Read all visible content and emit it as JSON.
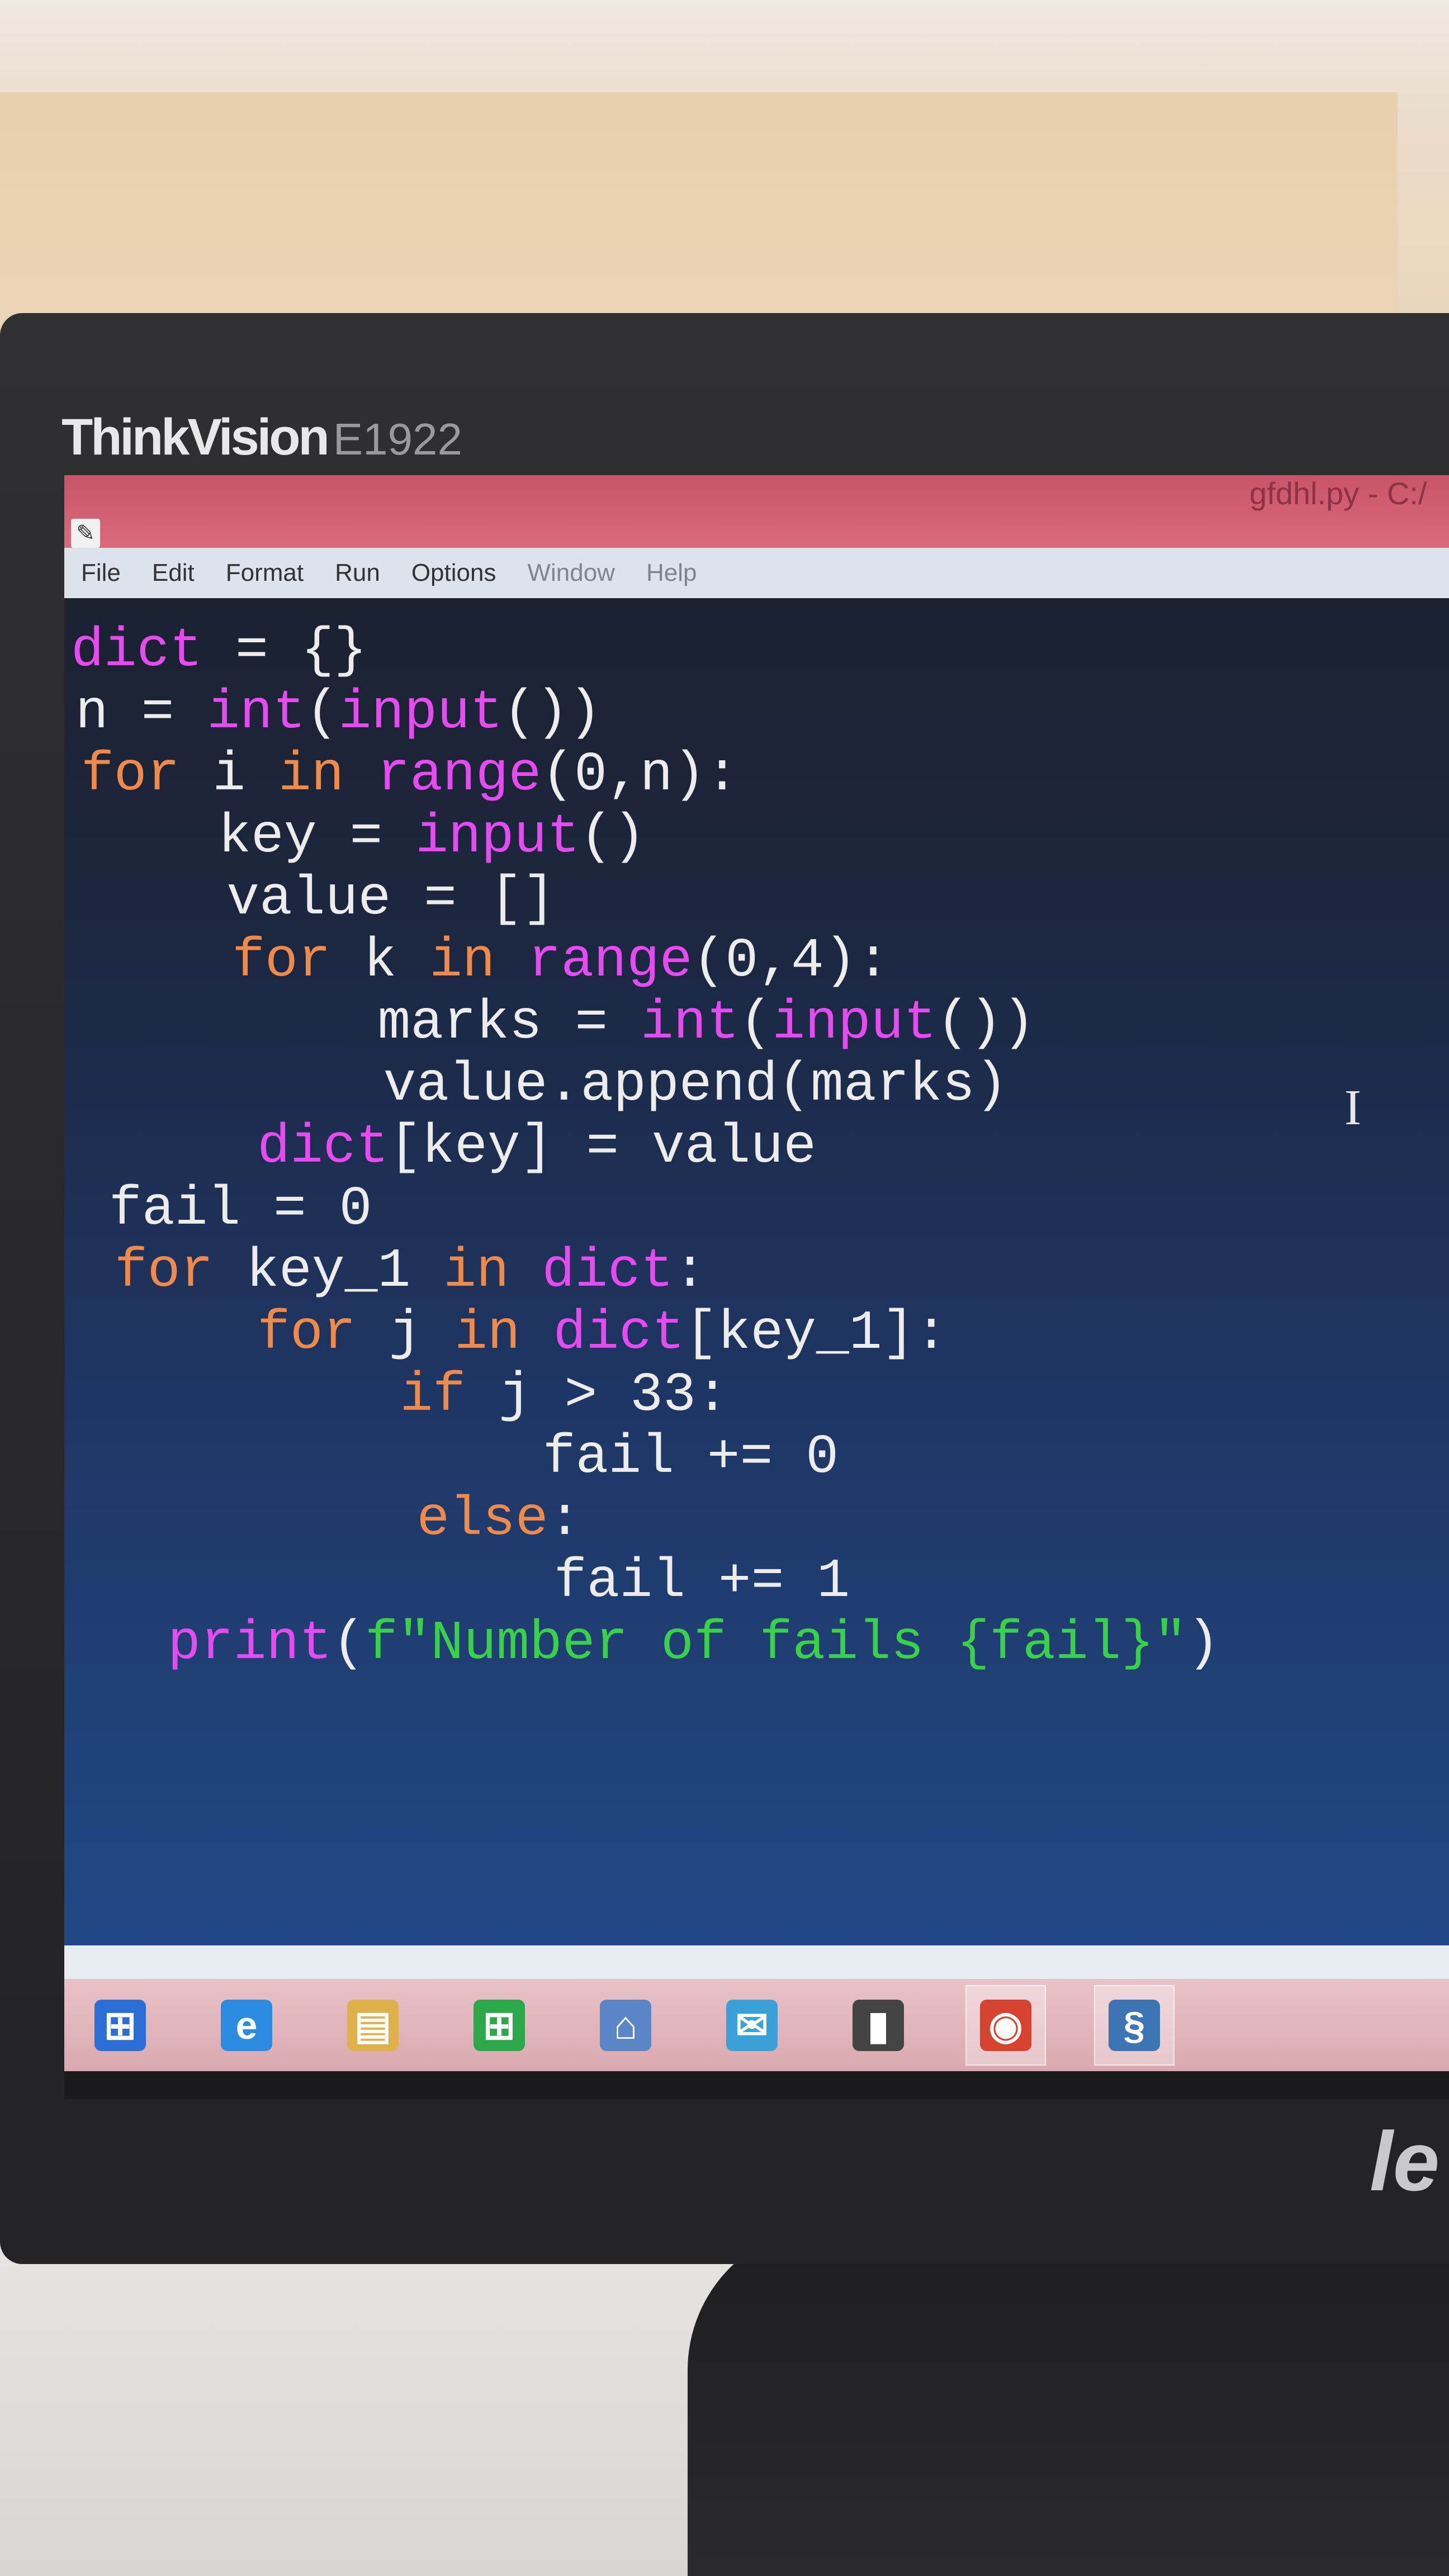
{
  "monitor": {
    "brand": "ThinkVision",
    "model": "E1922",
    "bezel_logo": "le"
  },
  "window": {
    "title": "gfdhl.py - C:/",
    "app_icon": "idle-icon"
  },
  "menubar": {
    "items": [
      "File",
      "Edit",
      "Format",
      "Run",
      "Options",
      "Window",
      "Help"
    ]
  },
  "code": [
    [
      {
        "t": "dict",
        "c": "bi"
      },
      {
        "t": " = {}",
        "c": ""
      }
    ],
    [
      {
        "t": "n = ",
        "c": ""
      },
      {
        "t": "int",
        "c": "bi"
      },
      {
        "t": "(",
        "c": ""
      },
      {
        "t": "input",
        "c": "bi"
      },
      {
        "t": "())",
        "c": ""
      }
    ],
    [
      {
        "t": "for",
        "c": "kw"
      },
      {
        "t": " i ",
        "c": ""
      },
      {
        "t": "in",
        "c": "kw"
      },
      {
        "t": " ",
        "c": ""
      },
      {
        "t": "range",
        "c": "bi"
      },
      {
        "t": "(0,n):",
        "c": ""
      }
    ],
    [
      {
        "t": "    key = ",
        "c": ""
      },
      {
        "t": "input",
        "c": "bi"
      },
      {
        "t": "()",
        "c": ""
      }
    ],
    [
      {
        "t": "    value = []",
        "c": ""
      }
    ],
    [
      {
        "t": "    ",
        "c": ""
      },
      {
        "t": "for",
        "c": "kw"
      },
      {
        "t": " k ",
        "c": ""
      },
      {
        "t": "in",
        "c": "kw"
      },
      {
        "t": " ",
        "c": ""
      },
      {
        "t": "range",
        "c": "bi"
      },
      {
        "t": "(0,4):",
        "c": ""
      }
    ],
    [
      {
        "t": "        marks = ",
        "c": ""
      },
      {
        "t": "int",
        "c": "bi"
      },
      {
        "t": "(",
        "c": ""
      },
      {
        "t": "input",
        "c": "bi"
      },
      {
        "t": "())",
        "c": ""
      }
    ],
    [
      {
        "t": "        value.append(marks)",
        "c": ""
      }
    ],
    [
      {
        "t": "    ",
        "c": ""
      },
      {
        "t": "dict",
        "c": "bi"
      },
      {
        "t": "[key] = value",
        "c": ""
      }
    ],
    [
      {
        "t": "fail = 0",
        "c": ""
      }
    ],
    [
      {
        "t": "for",
        "c": "kw"
      },
      {
        "t": " key_1 ",
        "c": ""
      },
      {
        "t": "in",
        "c": "kw"
      },
      {
        "t": " ",
        "c": ""
      },
      {
        "t": "dict",
        "c": "bi"
      },
      {
        "t": ":",
        "c": ""
      }
    ],
    [
      {
        "t": "    ",
        "c": ""
      },
      {
        "t": "for",
        "c": "kw"
      },
      {
        "t": " j ",
        "c": ""
      },
      {
        "t": "in",
        "c": "kw"
      },
      {
        "t": " ",
        "c": ""
      },
      {
        "t": "dict",
        "c": "bi"
      },
      {
        "t": "[key_1]:",
        "c": ""
      }
    ],
    [
      {
        "t": "        ",
        "c": ""
      },
      {
        "t": "if",
        "c": "kw"
      },
      {
        "t": " j > 33:",
        "c": ""
      }
    ],
    [
      {
        "t": "            fail += 0",
        "c": ""
      }
    ],
    [
      {
        "t": "        ",
        "c": ""
      },
      {
        "t": "else",
        "c": "kw"
      },
      {
        "t": ":",
        "c": ""
      }
    ],
    [
      {
        "t": "            fail += 1",
        "c": ""
      }
    ],
    [
      {
        "t": "print",
        "c": "bi"
      },
      {
        "t": "(",
        "c": ""
      },
      {
        "t": "f\"Number of fails {fail}\"",
        "c": "str"
      },
      {
        "t": ")",
        "c": ""
      }
    ]
  ],
  "taskbar": {
    "items": [
      {
        "name": "start-icon",
        "glyph": "⊞",
        "bg": "#2b6fd6",
        "active": false
      },
      {
        "name": "internet-explorer-icon",
        "glyph": "e",
        "bg": "#2a8be0",
        "active": false
      },
      {
        "name": "file-explorer-icon",
        "glyph": "▤",
        "bg": "#e0b04a",
        "active": false
      },
      {
        "name": "store-icon",
        "glyph": "⊞",
        "bg": "#2aa84a",
        "active": false
      },
      {
        "name": "home-icon",
        "glyph": "⌂",
        "bg": "#5a86c8",
        "active": false
      },
      {
        "name": "mail-icon",
        "glyph": "✉",
        "bg": "#3aa0d8",
        "active": false
      },
      {
        "name": "usb-drive-icon",
        "glyph": "▮",
        "bg": "#444444",
        "active": false
      },
      {
        "name": "chrome-icon",
        "glyph": "◉",
        "bg": "#d8432f",
        "active": true
      },
      {
        "name": "python-idle-icon",
        "glyph": "§",
        "bg": "#3c74b4",
        "active": true
      }
    ]
  },
  "colors": {
    "keyword": "#f08a4b",
    "builtin": "#e54bf0",
    "string": "#3ad14a",
    "text": "#ececec"
  }
}
